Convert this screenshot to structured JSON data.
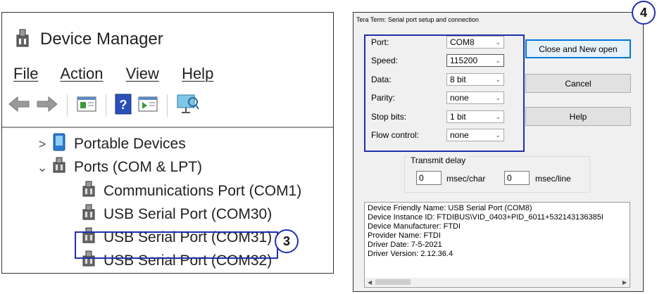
{
  "device_manager": {
    "title": "Device Manager",
    "menu": [
      "File",
      "Action",
      "View",
      "Help"
    ],
    "toolbar_icons": [
      "back-arrow-icon",
      "forward-arrow-icon",
      "properties-icon",
      "help-icon",
      "update-driver-icon",
      "scan-hardware-icon"
    ],
    "tree": [
      {
        "label": "Portable Devices",
        "expand": ">",
        "icon": "portable-device-icon"
      },
      {
        "label": "Ports (COM & LPT)",
        "expand": "⌄",
        "icon": "port-icon"
      },
      {
        "label": "Communications Port (COM1)",
        "icon": "port-icon"
      },
      {
        "label": "USB Serial Port (COM30)",
        "icon": "port-icon"
      },
      {
        "label": "USB Serial Port (COM31)",
        "icon": "port-icon"
      },
      {
        "label": "USB Serial Port (COM32)",
        "icon": "port-icon"
      }
    ],
    "callout_number": "3"
  },
  "tera_term": {
    "title": "Tera Term: Serial port setup and connection",
    "callout_number": "4",
    "fields": [
      {
        "label": "Port:",
        "value": "COM8"
      },
      {
        "label": "Speed:",
        "value": "115200"
      },
      {
        "label": "Data:",
        "value": "8 bit"
      },
      {
        "label": "Parity:",
        "value": "none"
      },
      {
        "label": "Stop bits:",
        "value": "1 bit"
      },
      {
        "label": "Flow control:",
        "value": "none"
      }
    ],
    "buttons": {
      "close_new_open": "Close and New open",
      "cancel": "Cancel",
      "help": "Help"
    },
    "transmit_delay": {
      "label": "Transmit delay",
      "char_value": "0",
      "char_unit": "msec/char",
      "line_value": "0",
      "line_unit": "msec/line"
    },
    "info_lines": [
      "Device Friendly Name: USB Serial Port (COM8)",
      "Device Instance ID: FTDIBUS\\VID_0403+PID_6011+532143136385I",
      "Device Manufacturer: FTDI",
      "Provider Name: FTDI",
      "Driver Date: 7-5-2021",
      "Driver Version: 2.12.36.4"
    ]
  },
  "colors": {
    "callout": "#2030b0",
    "default_button": "#0078d7"
  }
}
